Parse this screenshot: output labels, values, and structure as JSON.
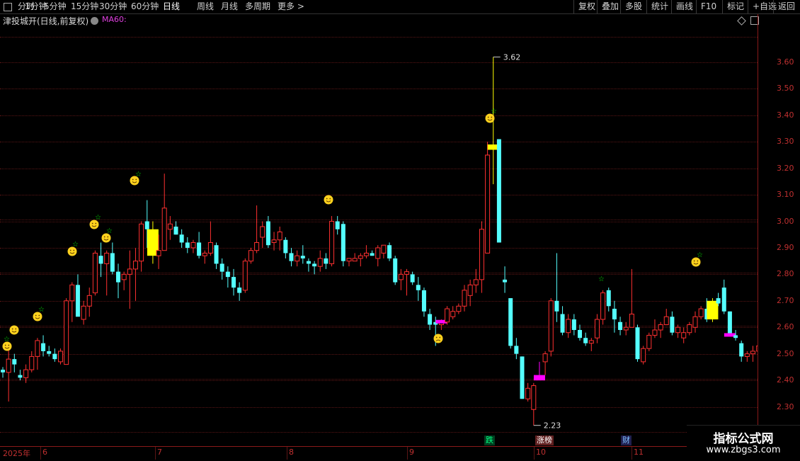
{
  "toolbar": {
    "left_items": [
      "分时",
      "1分钟",
      "5分钟",
      "15分钟",
      "30分钟",
      "60分钟",
      "日线",
      "周线",
      "月线",
      "多周期",
      "更多 >"
    ],
    "active": "日线",
    "right_items": [
      "复权",
      "叠加",
      "多股",
      "统计",
      "画线",
      "F10",
      "标记",
      "+自选",
      "返回"
    ]
  },
  "title": {
    "stock": "津投城开(日线,前复权)",
    "ma_label": "MA60:"
  },
  "colors": {
    "up": "#ff3030",
    "down": "#54ffff",
    "yellow": "#ffff00",
    "magenta": "#ff00ff",
    "axis": "#c03030"
  },
  "x_labels": [
    "2025年",
    "6",
    "7",
    "8",
    "9",
    "10",
    "11"
  ],
  "badges": [
    {
      "label": "跌",
      "color": "#00ff80",
      "bg": "#004020"
    },
    {
      "label": "涨榜",
      "color": "#ffffff",
      "bg": "#602020"
    },
    {
      "label": "财",
      "color": "#80c0ff",
      "bg": "#202050"
    }
  ],
  "watermark": {
    "title": "指标公式网",
    "url": "www.zbgs3.com"
  },
  "chart_data": {
    "type": "candlestick",
    "yticks": [
      "3.60",
      "3.50",
      "3.40",
      "3.30",
      "3.20",
      "3.10",
      "3.00",
      "2.90",
      "2.80",
      "2.70",
      "2.60",
      "2.50",
      "2.40",
      "2.30"
    ],
    "ylim": [
      2.18,
      3.68
    ],
    "max_label": "3.62",
    "min_label": "2.23",
    "candles": [
      [
        2.44,
        2.45,
        2.41,
        2.43
      ],
      [
        2.43,
        2.53,
        2.32,
        2.48
      ],
      [
        2.48,
        2.5,
        2.43,
        2.46
      ],
      [
        2.42,
        2.44,
        2.4,
        2.41
      ],
      [
        2.41,
        2.46,
        2.39,
        2.44
      ],
      [
        2.44,
        2.51,
        2.43,
        2.49
      ],
      [
        2.49,
        2.56,
        2.44,
        2.55
      ],
      [
        2.54,
        2.57,
        2.49,
        2.51
      ],
      [
        2.51,
        2.53,
        2.49,
        2.5
      ],
      [
        2.5,
        2.52,
        2.47,
        2.48
      ],
      [
        2.47,
        2.52,
        2.46,
        2.51
      ],
      [
        2.46,
        2.71,
        2.46,
        2.7
      ],
      [
        2.7,
        2.77,
        2.62,
        2.76
      ],
      [
        2.76,
        2.8,
        2.65,
        2.64
      ],
      [
        2.63,
        2.7,
        2.61,
        2.68
      ],
      [
        2.68,
        2.75,
        2.64,
        2.72
      ],
      [
        2.73,
        2.89,
        2.72,
        2.88
      ],
      [
        2.87,
        2.92,
        2.79,
        2.84
      ],
      [
        2.84,
        2.89,
        2.72,
        2.88
      ],
      [
        2.88,
        2.92,
        2.8,
        2.81
      ],
      [
        2.81,
        2.84,
        2.71,
        2.77
      ],
      [
        2.78,
        2.81,
        2.74,
        2.8
      ],
      [
        2.8,
        2.89,
        2.67,
        2.82
      ],
      [
        2.82,
        2.9,
        2.7,
        2.85
      ],
      [
        2.85,
        3.0,
        2.81,
        2.99
      ],
      [
        3.0,
        3.08,
        2.9,
        2.97
      ],
      [
        2.97,
        3.0,
        2.84,
        2.87
      ],
      [
        2.87,
        2.95,
        2.82,
        2.89
      ],
      [
        2.89,
        3.18,
        2.93,
        3.05
      ],
      [
        2.97,
        3.02,
        2.93,
        2.99
      ],
      [
        2.98,
        3.0,
        2.95,
        2.95
      ],
      [
        2.95,
        2.97,
        2.9,
        2.92
      ],
      [
        2.92,
        2.94,
        2.88,
        2.9
      ],
      [
        2.9,
        2.93,
        2.88,
        2.92
      ],
      [
        2.92,
        2.96,
        2.86,
        2.87
      ],
      [
        2.87,
        2.89,
        2.84,
        2.88
      ],
      [
        2.88,
        3.0,
        2.87,
        2.92
      ],
      [
        2.91,
        2.92,
        2.82,
        2.84
      ],
      [
        2.84,
        2.86,
        2.78,
        2.81
      ],
      [
        2.81,
        2.83,
        2.75,
        2.79
      ],
      [
        2.79,
        2.82,
        2.72,
        2.75
      ],
      [
        2.75,
        2.77,
        2.7,
        2.73
      ],
      [
        2.74,
        2.86,
        2.73,
        2.85
      ],
      [
        2.85,
        2.9,
        2.84,
        2.89
      ],
      [
        2.89,
        3.06,
        2.88,
        2.92
      ],
      [
        2.94,
        3.0,
        2.9,
        2.98
      ],
      [
        3.0,
        3.02,
        2.9,
        2.91
      ],
      [
        2.92,
        2.96,
        2.89,
        2.93
      ],
      [
        2.93,
        2.98,
        2.89,
        2.96
      ],
      [
        2.93,
        2.94,
        2.86,
        2.88
      ],
      [
        2.88,
        2.9,
        2.83,
        2.85
      ],
      [
        2.85,
        2.89,
        2.83,
        2.87
      ],
      [
        2.87,
        2.91,
        2.84,
        2.86
      ],
      [
        2.85,
        2.86,
        2.81,
        2.84
      ],
      [
        2.84,
        2.85,
        2.8,
        2.83
      ],
      [
        2.83,
        2.89,
        2.81,
        2.86
      ],
      [
        2.86,
        2.88,
        2.82,
        2.84
      ],
      [
        2.84,
        3.02,
        2.83,
        3.0
      ],
      [
        3.0,
        3.02,
        2.95,
        2.97
      ],
      [
        2.99,
        3.0,
        2.83,
        2.85
      ],
      [
        2.85,
        2.86,
        2.83,
        2.86
      ],
      [
        2.85,
        2.88,
        2.85,
        2.86
      ],
      [
        2.86,
        2.88,
        2.83,
        2.87
      ],
      [
        2.87,
        2.91,
        2.86,
        2.88
      ],
      [
        2.88,
        2.89,
        2.87,
        2.87
      ],
      [
        2.86,
        2.91,
        2.83,
        2.9
      ],
      [
        2.88,
        2.91,
        2.86,
        2.91
      ],
      [
        2.91,
        2.92,
        2.85,
        2.86
      ],
      [
        2.86,
        2.87,
        2.76,
        2.77
      ],
      [
        2.78,
        2.82,
        2.74,
        2.8
      ],
      [
        2.8,
        2.82,
        2.72,
        2.81
      ],
      [
        2.8,
        2.81,
        2.76,
        2.77
      ],
      [
        2.76,
        2.79,
        2.7,
        2.74
      ],
      [
        2.74,
        2.75,
        2.64,
        2.66
      ],
      [
        2.65,
        2.67,
        2.59,
        2.61
      ],
      [
        2.62,
        2.64,
        2.53,
        2.61
      ],
      [
        2.61,
        2.63,
        2.59,
        2.62
      ],
      [
        2.62,
        2.68,
        2.61,
        2.67
      ],
      [
        2.64,
        2.68,
        2.63,
        2.66
      ],
      [
        2.66,
        2.69,
        2.65,
        2.68
      ],
      [
        2.68,
        2.76,
        2.66,
        2.74
      ],
      [
        2.72,
        2.78,
        2.68,
        2.76
      ],
      [
        2.76,
        2.82,
        2.73,
        2.78
      ],
      [
        2.78,
        3.0,
        2.73,
        2.97
      ],
      [
        2.88,
        3.3,
        2.89,
        3.25
      ],
      [
        3.29,
        3.62,
        3.14,
        3.27
      ],
      [
        3.31,
        3.31,
        2.92,
        2.92
      ],
      [
        2.78,
        2.83,
        2.73,
        2.77
      ],
      [
        2.71,
        2.71,
        2.52,
        2.53
      ],
      [
        2.53,
        2.56,
        2.48,
        2.5
      ],
      [
        2.49,
        2.49,
        2.33,
        2.33
      ],
      [
        2.33,
        2.39,
        2.32,
        2.37
      ],
      [
        2.29,
        2.39,
        2.23,
        2.38
      ],
      [
        2.4,
        2.47,
        2.42,
        2.42
      ],
      [
        2.47,
        2.51,
        2.42,
        2.5
      ],
      [
        2.51,
        2.71,
        2.49,
        2.7
      ],
      [
        2.7,
        2.88,
        2.62,
        2.66
      ],
      [
        2.65,
        2.68,
        2.57,
        2.58
      ],
      [
        2.58,
        2.65,
        2.56,
        2.63
      ],
      [
        2.63,
        2.65,
        2.57,
        2.59
      ],
      [
        2.59,
        2.61,
        2.55,
        2.56
      ],
      [
        2.56,
        2.58,
        2.53,
        2.54
      ],
      [
        2.54,
        2.56,
        2.51,
        2.55
      ],
      [
        2.56,
        2.65,
        2.54,
        2.63
      ],
      [
        2.63,
        2.74,
        2.61,
        2.73
      ],
      [
        2.74,
        2.75,
        2.66,
        2.68
      ],
      [
        2.67,
        2.7,
        2.58,
        2.63
      ],
      [
        2.62,
        2.64,
        2.57,
        2.59
      ],
      [
        2.59,
        2.62,
        2.57,
        2.6
      ],
      [
        2.6,
        2.82,
        2.6,
        2.65
      ],
      [
        2.6,
        2.61,
        2.47,
        2.48
      ],
      [
        2.47,
        2.53,
        2.46,
        2.52
      ],
      [
        2.52,
        2.58,
        2.51,
        2.57
      ],
      [
        2.57,
        2.63,
        2.56,
        2.59
      ],
      [
        2.59,
        2.62,
        2.56,
        2.61
      ],
      [
        2.61,
        2.67,
        2.61,
        2.64
      ],
      [
        2.64,
        2.66,
        2.57,
        2.58
      ],
      [
        2.58,
        2.61,
        2.56,
        2.6
      ],
      [
        2.56,
        2.6,
        2.54,
        2.58
      ],
      [
        2.58,
        2.62,
        2.57,
        2.61
      ],
      [
        2.6,
        2.66,
        2.58,
        2.64
      ],
      [
        2.64,
        2.68,
        2.63,
        2.67
      ],
      [
        2.67,
        2.71,
        2.62,
        2.63
      ],
      [
        2.63,
        2.71,
        2.62,
        2.7
      ],
      [
        2.71,
        2.73,
        2.68,
        2.69
      ],
      [
        2.75,
        2.78,
        2.65,
        2.66
      ],
      [
        2.66,
        2.66,
        2.57,
        2.57
      ],
      [
        2.57,
        2.59,
        2.55,
        2.56
      ],
      [
        2.54,
        2.55,
        2.47,
        2.49
      ],
      [
        2.49,
        2.51,
        2.47,
        2.5
      ],
      [
        2.5,
        2.53,
        2.47,
        2.51
      ],
      [
        2.51,
        2.54,
        2.5,
        2.53
      ],
      [
        2.53,
        2.59,
        2.52,
        2.56
      ],
      [
        2.56,
        2.58,
        2.48,
        2.52
      ],
      [
        2.52,
        2.58,
        2.51,
        2.57
      ]
    ],
    "yellow_blocks": [
      26,
      85,
      123
    ],
    "magenta_blocks": [
      93
    ],
    "magenta_bars": [
      76,
      126
    ]
  }
}
